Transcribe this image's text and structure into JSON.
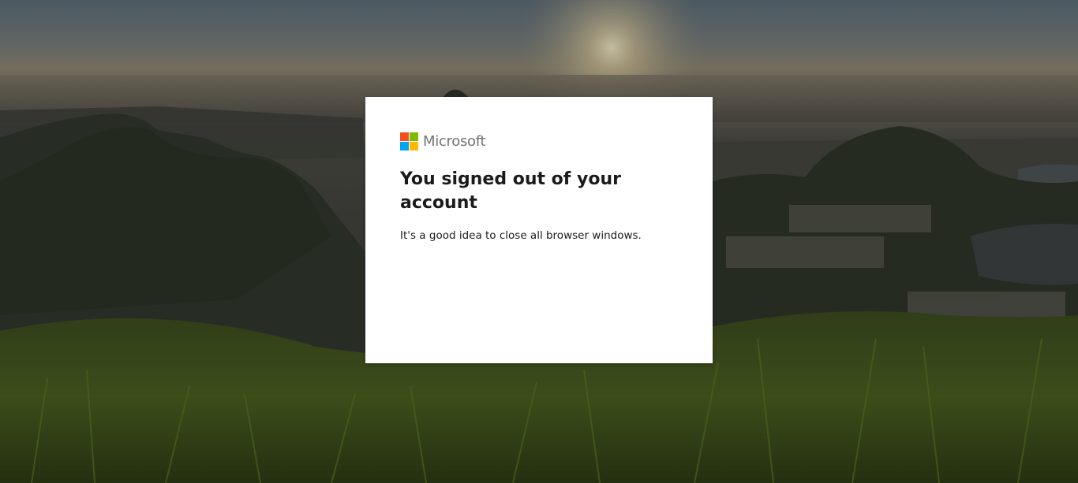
{
  "brand": {
    "name": "Microsoft",
    "logo_colors": [
      "#f25022",
      "#7fba00",
      "#00a4ef",
      "#ffb900"
    ]
  },
  "card": {
    "title": "You signed out of your account",
    "message": "It's a good idea to close all browser windows."
  },
  "background": {
    "description_icon": "landscape-background-image",
    "sky_color": "#6f7d86",
    "sun_color": "#e8d9a8",
    "hills_color": "#2c3528",
    "grass_color": "#465a1f"
  }
}
